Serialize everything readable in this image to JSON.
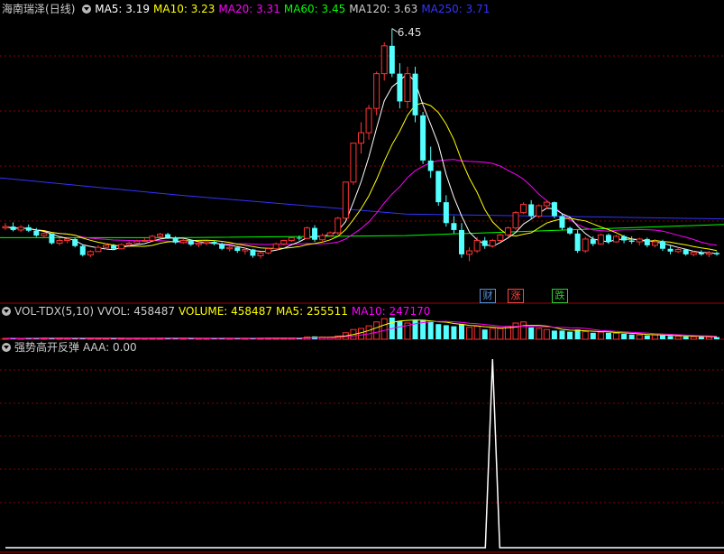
{
  "main_header": {
    "stock": "海南瑞泽",
    "period": "(日线)",
    "ma": [
      {
        "label": "MA5: 3.19",
        "color": "#ffffff"
      },
      {
        "label": "MA10: 3.23",
        "color": "#ffff00"
      },
      {
        "label": "MA20: 3.31",
        "color": "#ff00ff"
      },
      {
        "label": "MA60: 3.45",
        "color": "#00ff00"
      },
      {
        "label": "MA120: 3.63",
        "color": "#cccccc"
      },
      {
        "label": "MA250: 3.71",
        "color": "#3333ff"
      }
    ]
  },
  "peak_label": "6.45",
  "badges": [
    {
      "text": "财",
      "color": "#5b8fd9"
    },
    {
      "text": "涨",
      "color": "#ff4444"
    },
    {
      "text": "跌",
      "color": "#33cc33"
    }
  ],
  "vol_header": {
    "name": "VOL-TDX(5,10)",
    "items": [
      {
        "label": "VVOL: 458487",
        "color": "#cccccc"
      },
      {
        "label": "VOLUME: 458487",
        "color": "#ffff00"
      },
      {
        "label": "MA5: 255511",
        "color": "#ffff00"
      },
      {
        "label": "MA10: 247170",
        "color": "#ff00ff"
      }
    ]
  },
  "ind_header": {
    "name": "强势高开反弹",
    "value": "AAA: 0.00"
  },
  "colors": {
    "up": "#ff3333",
    "down": "#54ffff",
    "ma5": "#ffffff",
    "ma10": "#ffff00",
    "ma20": "#ff00ff",
    "ma60": "#00ff00",
    "ma250": "#3333ff",
    "grid": "#8b0000",
    "panel_border": "#aa0000"
  },
  "chart_data": {
    "type": "candlestick",
    "ohlc": [
      [
        3.58,
        3.65,
        3.55,
        3.6
      ],
      [
        3.6,
        3.66,
        3.53,
        3.55
      ],
      [
        3.55,
        3.62,
        3.52,
        3.59
      ],
      [
        3.59,
        3.63,
        3.52,
        3.54
      ],
      [
        3.54,
        3.58,
        3.45,
        3.47
      ],
      [
        3.47,
        3.52,
        3.44,
        3.5
      ],
      [
        3.5,
        3.5,
        3.34,
        3.36
      ],
      [
        3.36,
        3.43,
        3.33,
        3.4
      ],
      [
        3.4,
        3.45,
        3.36,
        3.42
      ],
      [
        3.42,
        3.44,
        3.3,
        3.32
      ],
      [
        3.32,
        3.34,
        3.17,
        3.19
      ],
      [
        3.19,
        3.26,
        3.16,
        3.24
      ],
      [
        3.24,
        3.33,
        3.23,
        3.3
      ],
      [
        3.3,
        3.36,
        3.27,
        3.33
      ],
      [
        3.33,
        3.35,
        3.26,
        3.28
      ],
      [
        3.28,
        3.36,
        3.27,
        3.34
      ],
      [
        3.34,
        3.38,
        3.3,
        3.36
      ],
      [
        3.36,
        3.41,
        3.35,
        3.39
      ],
      [
        3.39,
        3.43,
        3.38,
        3.4
      ],
      [
        3.4,
        3.48,
        3.39,
        3.46
      ],
      [
        3.46,
        3.51,
        3.43,
        3.49
      ],
      [
        3.49,
        3.51,
        3.42,
        3.44
      ],
      [
        3.44,
        3.46,
        3.35,
        3.37
      ],
      [
        3.37,
        3.43,
        3.35,
        3.4
      ],
      [
        3.4,
        3.41,
        3.32,
        3.34
      ],
      [
        3.34,
        3.38,
        3.3,
        3.36
      ],
      [
        3.36,
        3.39,
        3.33,
        3.38
      ],
      [
        3.38,
        3.4,
        3.33,
        3.35
      ],
      [
        3.35,
        3.37,
        3.26,
        3.28
      ],
      [
        3.28,
        3.32,
        3.24,
        3.3
      ],
      [
        3.3,
        3.32,
        3.22,
        3.25
      ],
      [
        3.25,
        3.3,
        3.2,
        3.27
      ],
      [
        3.27,
        3.28,
        3.15,
        3.18
      ],
      [
        3.18,
        3.24,
        3.14,
        3.22
      ],
      [
        3.22,
        3.3,
        3.2,
        3.28
      ],
      [
        3.28,
        3.37,
        3.27,
        3.35
      ],
      [
        3.35,
        3.41,
        3.33,
        3.4
      ],
      [
        3.4,
        3.45,
        3.38,
        3.44
      ],
      [
        3.44,
        3.47,
        3.4,
        3.43
      ],
      [
        3.43,
        3.6,
        3.42,
        3.58
      ],
      [
        3.58,
        3.62,
        3.38,
        3.41
      ],
      [
        3.41,
        3.5,
        3.39,
        3.47
      ],
      [
        3.47,
        3.53,
        3.45,
        3.51
      ],
      [
        3.51,
        3.74,
        3.48,
        3.72
      ],
      [
        3.72,
        4.24,
        3.7,
        4.24
      ],
      [
        4.24,
        4.8,
        4.2,
        4.8
      ],
      [
        4.8,
        5.1,
        4.65,
        4.95
      ],
      [
        4.95,
        5.35,
        4.85,
        5.3
      ],
      [
        5.3,
        5.83,
        5.2,
        5.8
      ],
      [
        5.8,
        6.25,
        5.7,
        6.2
      ],
      [
        6.2,
        6.45,
        5.75,
        5.8
      ],
      [
        5.8,
        5.95,
        5.3,
        5.4
      ],
      [
        5.4,
        5.9,
        5.3,
        5.8
      ],
      [
        5.8,
        5.9,
        5.1,
        5.2
      ],
      [
        5.2,
        5.25,
        4.5,
        4.55
      ],
      [
        4.55,
        4.75,
        4.3,
        4.4
      ],
      [
        4.4,
        4.4,
        3.9,
        3.95
      ],
      [
        3.95,
        4.05,
        3.6,
        3.65
      ],
      [
        3.65,
        3.75,
        3.5,
        3.55
      ],
      [
        3.55,
        3.65,
        3.15,
        3.2
      ],
      [
        3.2,
        3.3,
        3.1,
        3.25
      ],
      [
        3.25,
        3.45,
        3.22,
        3.4
      ],
      [
        3.4,
        3.45,
        3.28,
        3.32
      ],
      [
        3.32,
        3.42,
        3.3,
        3.4
      ],
      [
        3.4,
        3.5,
        3.38,
        3.48
      ],
      [
        3.48,
        3.6,
        3.45,
        3.58
      ],
      [
        3.58,
        3.82,
        3.55,
        3.8
      ],
      [
        3.8,
        3.95,
        3.78,
        3.92
      ],
      [
        3.92,
        3.98,
        3.7,
        3.75
      ],
      [
        3.75,
        3.92,
        3.72,
        3.9
      ],
      [
        3.9,
        3.98,
        3.85,
        3.95
      ],
      [
        3.95,
        3.96,
        3.72,
        3.75
      ],
      [
        3.75,
        3.78,
        3.55,
        3.58
      ],
      [
        3.58,
        3.6,
        3.48,
        3.5
      ],
      [
        3.5,
        3.55,
        3.22,
        3.25
      ],
      [
        3.25,
        3.45,
        3.22,
        3.42
      ],
      [
        3.42,
        3.46,
        3.32,
        3.35
      ],
      [
        3.35,
        3.5,
        3.34,
        3.48
      ],
      [
        3.48,
        3.5,
        3.35,
        3.38
      ],
      [
        3.38,
        3.48,
        3.37,
        3.46
      ],
      [
        3.46,
        3.48,
        3.36,
        3.4
      ],
      [
        3.4,
        3.46,
        3.35,
        3.38
      ],
      [
        3.38,
        3.44,
        3.33,
        3.42
      ],
      [
        3.42,
        3.44,
        3.3,
        3.33
      ],
      [
        3.33,
        3.42,
        3.3,
        3.38
      ],
      [
        3.38,
        3.41,
        3.25,
        3.28
      ],
      [
        3.28,
        3.32,
        3.2,
        3.24
      ],
      [
        3.24,
        3.3,
        3.22,
        3.27
      ],
      [
        3.27,
        3.28,
        3.18,
        3.2
      ],
      [
        3.2,
        3.25,
        3.17,
        3.23
      ],
      [
        3.23,
        3.26,
        3.18,
        3.2
      ],
      [
        3.2,
        3.25,
        3.16,
        3.22
      ],
      [
        3.22,
        3.24,
        3.18,
        3.2
      ]
    ],
    "volume_ratio": [
      0.04,
      0.05,
      0.04,
      0.05,
      0.05,
      0.05,
      0.06,
      0.05,
      0.04,
      0.05,
      0.06,
      0.05,
      0.05,
      0.04,
      0.04,
      0.05,
      0.04,
      0.05,
      0.04,
      0.05,
      0.05,
      0.05,
      0.05,
      0.04,
      0.05,
      0.04,
      0.04,
      0.05,
      0.05,
      0.04,
      0.05,
      0.04,
      0.05,
      0.05,
      0.05,
      0.06,
      0.06,
      0.06,
      0.05,
      0.1,
      0.13,
      0.1,
      0.1,
      0.15,
      0.3,
      0.45,
      0.5,
      0.62,
      0.8,
      0.95,
      1.0,
      0.85,
      0.75,
      0.9,
      0.9,
      0.8,
      0.7,
      0.65,
      0.6,
      0.7,
      0.55,
      0.6,
      0.45,
      0.5,
      0.5,
      0.6,
      0.75,
      0.8,
      0.55,
      0.5,
      0.45,
      0.4,
      0.4,
      0.35,
      0.45,
      0.35,
      0.3,
      0.33,
      0.3,
      0.28,
      0.25,
      0.22,
      0.2,
      0.18,
      0.2,
      0.18,
      0.15,
      0.14,
      0.13,
      0.12,
      0.12,
      0.11,
      0.1
    ],
    "indicator_aaa_nonzero_index": 63,
    "ylim": [
      2.9,
      6.6
    ]
  }
}
